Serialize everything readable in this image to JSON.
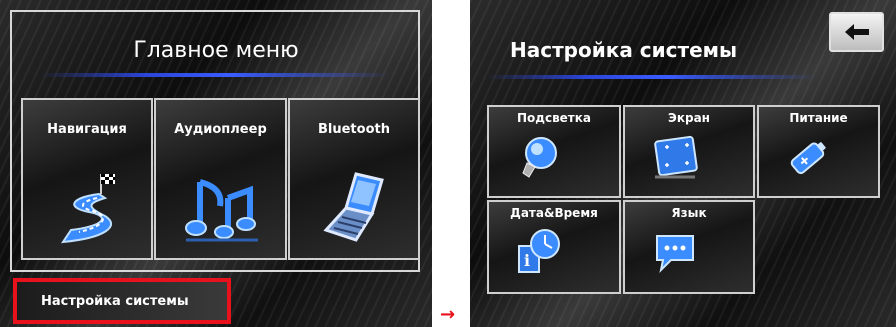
{
  "main_menu": {
    "title": "Главное меню",
    "items": [
      {
        "label": "Навигация",
        "icon": "navigation-road-icon"
      },
      {
        "label": "Аудиоплеер",
        "icon": "music-notes-icon"
      },
      {
        "label": "Bluetooth",
        "icon": "mobile-phone-icon"
      }
    ],
    "settings_button": "Настройка системы"
  },
  "transition_arrow": "→",
  "system_settings": {
    "title": "Настройка системы",
    "back_icon": "back-arrow-icon",
    "items": [
      {
        "label": "Подсветка",
        "icon": "light-bulb-icon"
      },
      {
        "label": "Экран",
        "icon": "screen-calibrate-icon"
      },
      {
        "label": "Питание",
        "icon": "battery-icon"
      },
      {
        "label": "Дата&Время",
        "icon": "clock-icon"
      },
      {
        "label": "Язык",
        "icon": "speech-bubble-icon"
      }
    ]
  },
  "colors": {
    "highlight": "#e8121c",
    "accent_line": "#2b45d8",
    "icon_blue": "#3a8cff"
  }
}
